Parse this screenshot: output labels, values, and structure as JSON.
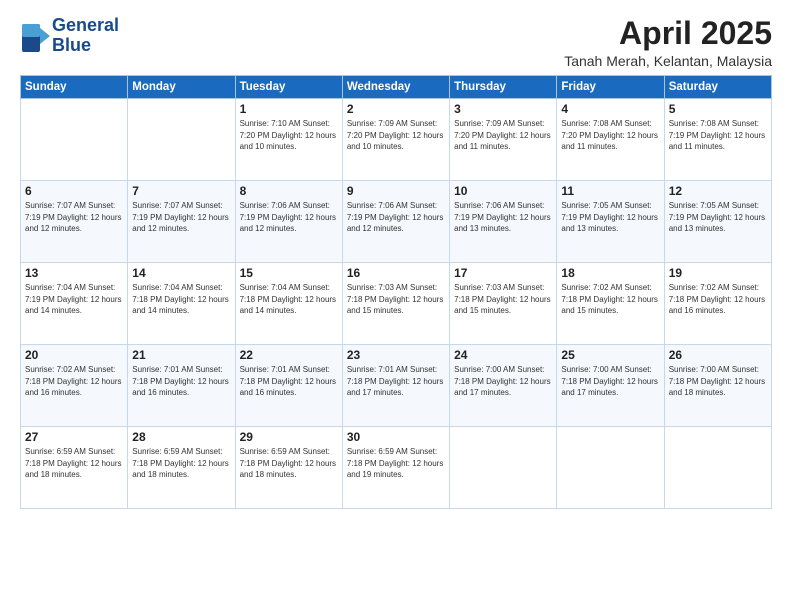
{
  "logo": {
    "line1": "General",
    "line2": "Blue"
  },
  "title": "April 2025",
  "location": "Tanah Merah, Kelantan, Malaysia",
  "days_header": [
    "Sunday",
    "Monday",
    "Tuesday",
    "Wednesday",
    "Thursday",
    "Friday",
    "Saturday"
  ],
  "weeks": [
    [
      {
        "day": "",
        "info": ""
      },
      {
        "day": "",
        "info": ""
      },
      {
        "day": "1",
        "info": "Sunrise: 7:10 AM\nSunset: 7:20 PM\nDaylight: 12 hours and 10 minutes."
      },
      {
        "day": "2",
        "info": "Sunrise: 7:09 AM\nSunset: 7:20 PM\nDaylight: 12 hours and 10 minutes."
      },
      {
        "day": "3",
        "info": "Sunrise: 7:09 AM\nSunset: 7:20 PM\nDaylight: 12 hours and 11 minutes."
      },
      {
        "day": "4",
        "info": "Sunrise: 7:08 AM\nSunset: 7:20 PM\nDaylight: 12 hours and 11 minutes."
      },
      {
        "day": "5",
        "info": "Sunrise: 7:08 AM\nSunset: 7:19 PM\nDaylight: 12 hours and 11 minutes."
      }
    ],
    [
      {
        "day": "6",
        "info": "Sunrise: 7:07 AM\nSunset: 7:19 PM\nDaylight: 12 hours and 12 minutes."
      },
      {
        "day": "7",
        "info": "Sunrise: 7:07 AM\nSunset: 7:19 PM\nDaylight: 12 hours and 12 minutes."
      },
      {
        "day": "8",
        "info": "Sunrise: 7:06 AM\nSunset: 7:19 PM\nDaylight: 12 hours and 12 minutes."
      },
      {
        "day": "9",
        "info": "Sunrise: 7:06 AM\nSunset: 7:19 PM\nDaylight: 12 hours and 12 minutes."
      },
      {
        "day": "10",
        "info": "Sunrise: 7:06 AM\nSunset: 7:19 PM\nDaylight: 12 hours and 13 minutes."
      },
      {
        "day": "11",
        "info": "Sunrise: 7:05 AM\nSunset: 7:19 PM\nDaylight: 12 hours and 13 minutes."
      },
      {
        "day": "12",
        "info": "Sunrise: 7:05 AM\nSunset: 7:19 PM\nDaylight: 12 hours and 13 minutes."
      }
    ],
    [
      {
        "day": "13",
        "info": "Sunrise: 7:04 AM\nSunset: 7:19 PM\nDaylight: 12 hours and 14 minutes."
      },
      {
        "day": "14",
        "info": "Sunrise: 7:04 AM\nSunset: 7:18 PM\nDaylight: 12 hours and 14 minutes."
      },
      {
        "day": "15",
        "info": "Sunrise: 7:04 AM\nSunset: 7:18 PM\nDaylight: 12 hours and 14 minutes."
      },
      {
        "day": "16",
        "info": "Sunrise: 7:03 AM\nSunset: 7:18 PM\nDaylight: 12 hours and 15 minutes."
      },
      {
        "day": "17",
        "info": "Sunrise: 7:03 AM\nSunset: 7:18 PM\nDaylight: 12 hours and 15 minutes."
      },
      {
        "day": "18",
        "info": "Sunrise: 7:02 AM\nSunset: 7:18 PM\nDaylight: 12 hours and 15 minutes."
      },
      {
        "day": "19",
        "info": "Sunrise: 7:02 AM\nSunset: 7:18 PM\nDaylight: 12 hours and 16 minutes."
      }
    ],
    [
      {
        "day": "20",
        "info": "Sunrise: 7:02 AM\nSunset: 7:18 PM\nDaylight: 12 hours and 16 minutes."
      },
      {
        "day": "21",
        "info": "Sunrise: 7:01 AM\nSunset: 7:18 PM\nDaylight: 12 hours and 16 minutes."
      },
      {
        "day": "22",
        "info": "Sunrise: 7:01 AM\nSunset: 7:18 PM\nDaylight: 12 hours and 16 minutes."
      },
      {
        "day": "23",
        "info": "Sunrise: 7:01 AM\nSunset: 7:18 PM\nDaylight: 12 hours and 17 minutes."
      },
      {
        "day": "24",
        "info": "Sunrise: 7:00 AM\nSunset: 7:18 PM\nDaylight: 12 hours and 17 minutes."
      },
      {
        "day": "25",
        "info": "Sunrise: 7:00 AM\nSunset: 7:18 PM\nDaylight: 12 hours and 17 minutes."
      },
      {
        "day": "26",
        "info": "Sunrise: 7:00 AM\nSunset: 7:18 PM\nDaylight: 12 hours and 18 minutes."
      }
    ],
    [
      {
        "day": "27",
        "info": "Sunrise: 6:59 AM\nSunset: 7:18 PM\nDaylight: 12 hours and 18 minutes."
      },
      {
        "day": "28",
        "info": "Sunrise: 6:59 AM\nSunset: 7:18 PM\nDaylight: 12 hours and 18 minutes."
      },
      {
        "day": "29",
        "info": "Sunrise: 6:59 AM\nSunset: 7:18 PM\nDaylight: 12 hours and 18 minutes."
      },
      {
        "day": "30",
        "info": "Sunrise: 6:59 AM\nSunset: 7:18 PM\nDaylight: 12 hours and 19 minutes."
      },
      {
        "day": "",
        "info": ""
      },
      {
        "day": "",
        "info": ""
      },
      {
        "day": "",
        "info": ""
      }
    ]
  ]
}
